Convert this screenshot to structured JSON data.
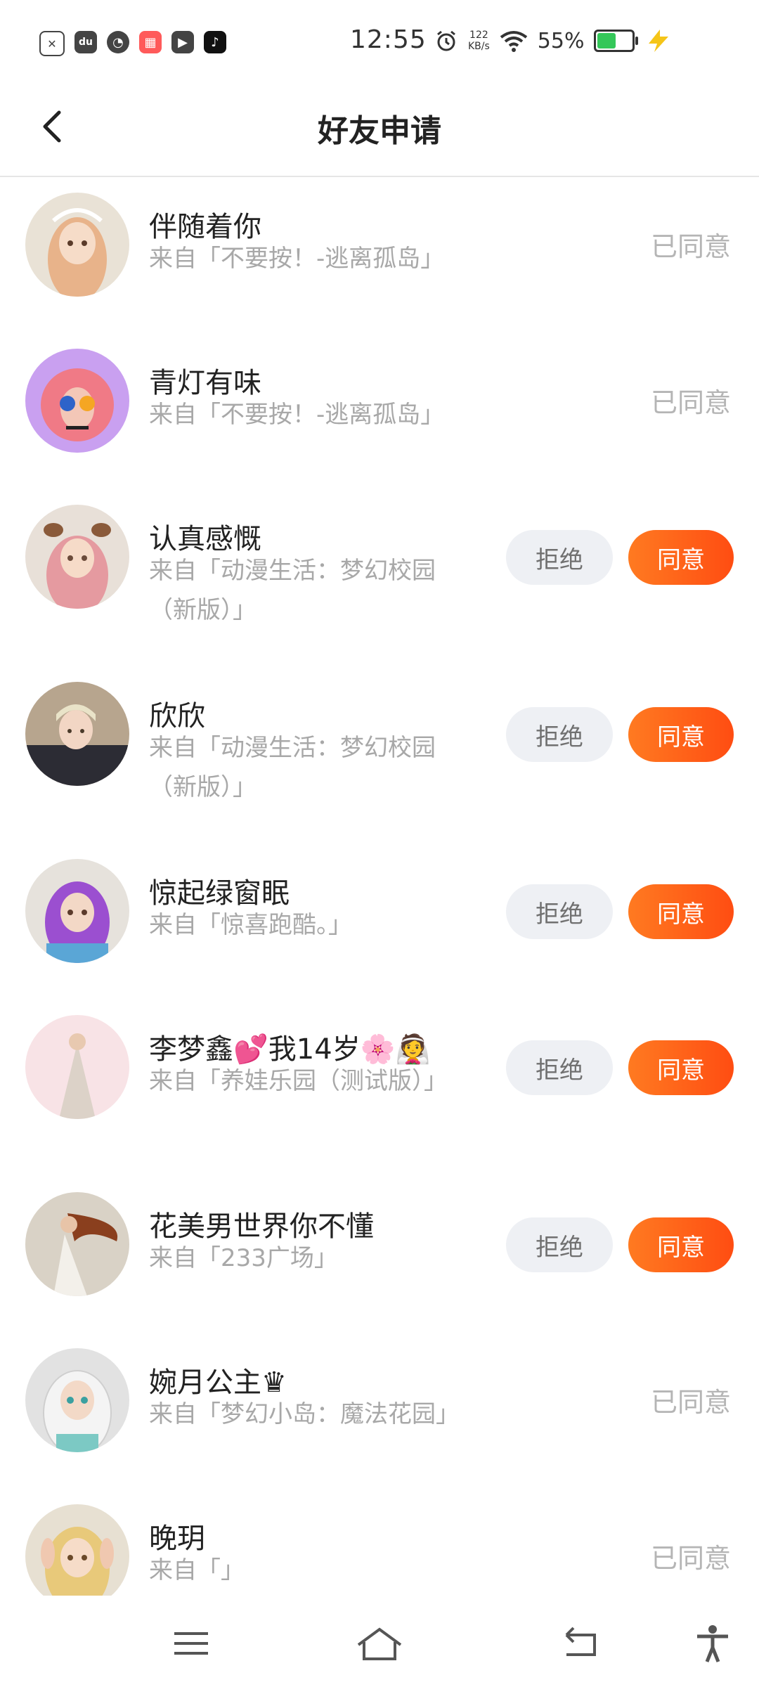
{
  "status_bar": {
    "time": "12:55",
    "net_speed_value": "122",
    "net_speed_unit": "KB/s",
    "battery_percent": "55%",
    "battery_level": 0.55,
    "app_icons": [
      "close-app-icon",
      "du-app-icon",
      "speedometer-app-icon",
      "grid-app-icon",
      "video-app-icon",
      "tiktok-app-icon"
    ]
  },
  "header": {
    "title": "好友申请"
  },
  "requests": [
    {
      "name": "伴随着你",
      "source": "来自「不要按！-逃离孤岛」",
      "status": "已同意"
    },
    {
      "name": "青灯有味",
      "source": "来自「不要按！-逃离孤岛」",
      "status": "已同意"
    },
    {
      "name": "认真感慨",
      "source": "来自「动漫生活：梦幻校园（新版）」",
      "reject": "拒绝",
      "accept": "同意"
    },
    {
      "name": "欣欣",
      "source": "来自「动漫生活：梦幻校园（新版）」",
      "reject": "拒绝",
      "accept": "同意"
    },
    {
      "name": "惊起绿窗眠",
      "source": "来自「惊喜跑酷。」",
      "reject": "拒绝",
      "accept": "同意"
    },
    {
      "name": "李梦鑫💕我14岁🌸👰",
      "source": "来自「养娃乐园（测试版）」",
      "reject": "拒绝",
      "accept": "同意"
    },
    {
      "name": "花美男世界你不懂",
      "source": "来自「233广场」",
      "reject": "拒绝",
      "accept": "同意"
    },
    {
      "name": "婉月公主♛",
      "source": "来自「梦幻小岛：魔法花园」",
      "status": "已同意"
    },
    {
      "name": "晚玥",
      "source": "来自「」",
      "status": "已同意"
    }
  ],
  "colors": {
    "accent": "#ff5a14",
    "reject_bg": "#eef0f4",
    "muted_text": "#a8a8a8"
  }
}
